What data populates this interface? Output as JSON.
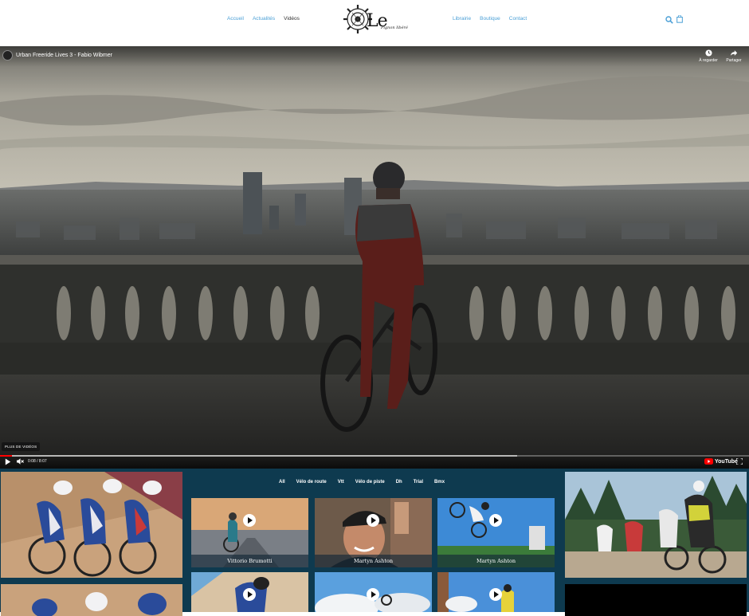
{
  "nav": {
    "left": [
      "Accueil",
      "Actualités",
      "Vidéos"
    ],
    "right": [
      "Librairie",
      "Boutique",
      "Contact"
    ],
    "active": "Vidéos"
  },
  "brand": {
    "logo_text": "Le",
    "logo_subtitle": "Pignon libéré"
  },
  "header_icons": [
    "search-icon",
    "shopping-bag-icon"
  ],
  "video": {
    "title": "Urban Freeride Lives 3 - Fabio Wibmer",
    "actions": {
      "watch_later": "À regarder",
      "share": "Partager"
    },
    "more_videos": "PLUS DE VIDÉOS",
    "time": "0:08 / 8:07",
    "progress_played": 0.016,
    "progress_loaded": 0.69,
    "youtube_label": "YouTube"
  },
  "filters": [
    "All",
    "Vélo de route",
    "Vtt",
    "Vélo de piste",
    "Dh",
    "Trial",
    "Bmx"
  ],
  "cards_row1": [
    {
      "label": "Vittorio Brumotti"
    },
    {
      "label": "Martyn Ashton"
    },
    {
      "label": "Martyn Ashton"
    }
  ],
  "colors": {
    "nav_link": "#4a9fd6",
    "panel_bg": "#0e3a4f",
    "progress": "#ff0000"
  }
}
